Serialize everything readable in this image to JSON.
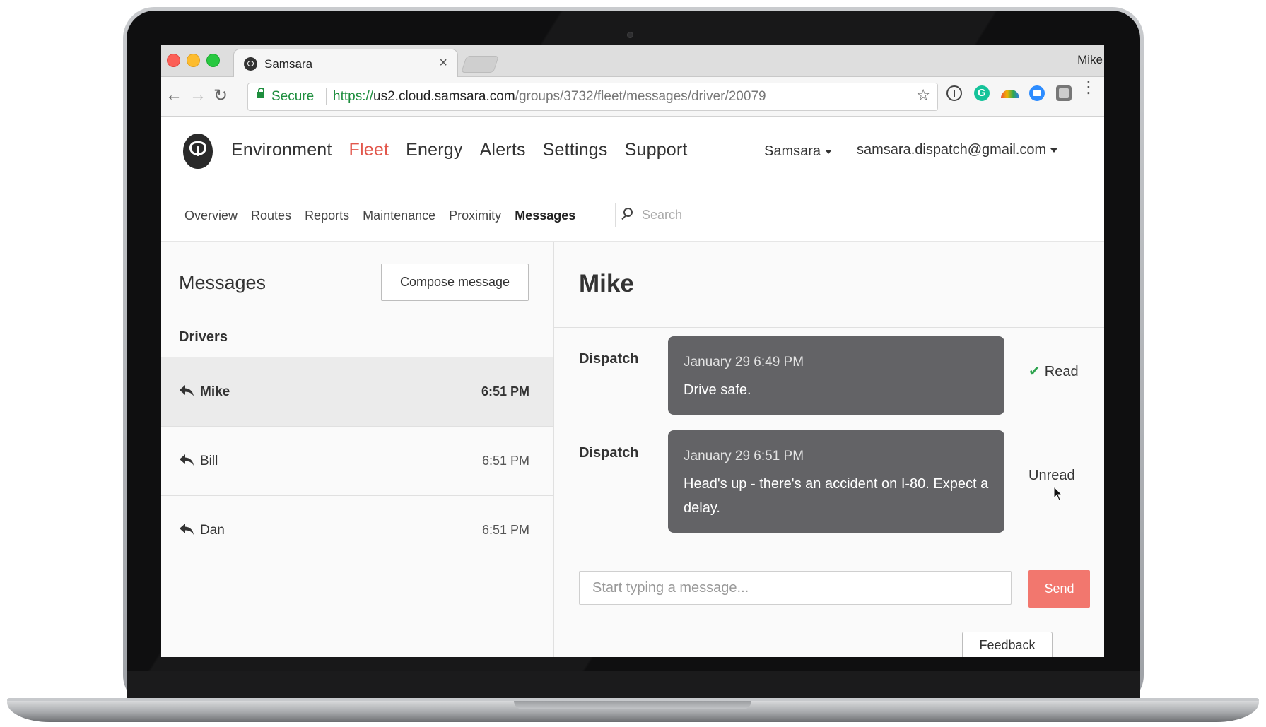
{
  "browser": {
    "tab_title": "Samsara",
    "tab_close": "×",
    "profile_name": "Mike",
    "secure_label": "Secure",
    "url_scheme": "https://",
    "url_host": "us2.cloud.samsara.com",
    "url_path": "/groups/3732/fleet/messages/driver/20079",
    "back_icon": "←",
    "forward_icon": "→",
    "reload_icon": "↻",
    "star_icon": "☆",
    "menu_icon": "⋮"
  },
  "header": {
    "nav": [
      {
        "label": "Environment",
        "active": false
      },
      {
        "label": "Fleet",
        "active": true
      },
      {
        "label": "Energy",
        "active": false
      },
      {
        "label": "Alerts",
        "active": false
      },
      {
        "label": "Settings",
        "active": false
      },
      {
        "label": "Support",
        "active": false
      }
    ],
    "org_selector": "Samsara",
    "account": "samsara.dispatch@gmail.com"
  },
  "subnav": {
    "items": [
      {
        "label": "Overview",
        "active": false
      },
      {
        "label": "Routes",
        "active": false
      },
      {
        "label": "Reports",
        "active": false
      },
      {
        "label": "Maintenance",
        "active": false
      },
      {
        "label": "Proximity",
        "active": false
      },
      {
        "label": "Messages",
        "active": true
      }
    ],
    "search_placeholder": "Search"
  },
  "messages_panel": {
    "title": "Messages",
    "compose_label": "Compose message",
    "section_title": "Drivers",
    "drivers": [
      {
        "name": "Mike",
        "time": "6:51 PM",
        "selected": true
      },
      {
        "name": "Bill",
        "time": "6:51 PM",
        "selected": false
      },
      {
        "name": "Dan",
        "time": "6:51 PM",
        "selected": false
      }
    ]
  },
  "conversation": {
    "title": "Mike",
    "messages": [
      {
        "sender": "Dispatch",
        "timestamp": "January 29 6:49 PM",
        "text": "Drive safe.",
        "status": "Read",
        "status_icon": "✔"
      },
      {
        "sender": "Dispatch",
        "timestamp": "January 29 6:51 PM",
        "text": "Head's up - there's an accident on I-80. Expect a delay.",
        "status": "Unread"
      }
    ],
    "input_placeholder": "Start typing a message...",
    "send_label": "Send",
    "feedback_label": "Feedback"
  },
  "colors": {
    "accent": "#e2574c",
    "send_button": "#f2776e",
    "bubble": "#636366",
    "read_check": "#2ea44f"
  }
}
